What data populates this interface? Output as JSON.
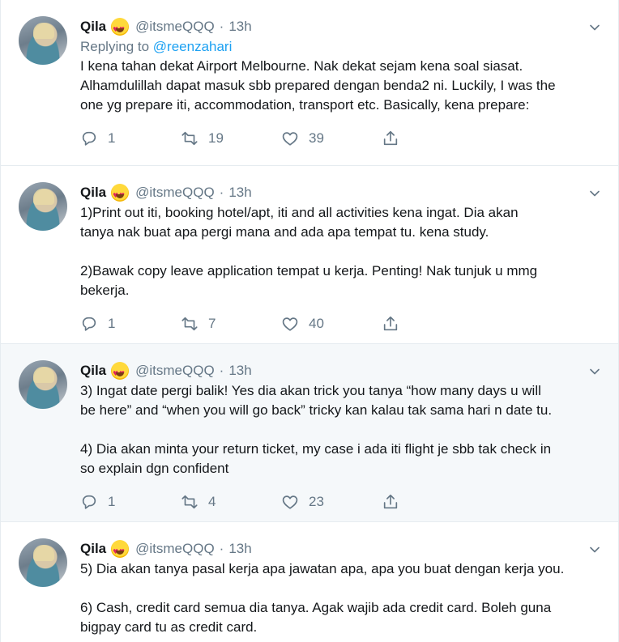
{
  "tweets": [
    {
      "name": "Qila",
      "handle": "@itsmeQQQ",
      "separator": "·",
      "time": "13h",
      "replying_prefix": "Replying to ",
      "replying_to": "@reenzahari",
      "text": "I kena tahan dekat Airport Melbourne. Nak dekat sejam kena soal siasat.\nAlhamdulillah dapat masuk sbb prepared dengan benda2 ni. Luckily, I was the\none yg prepare iti, accommodation, transport etc. Basically, kena prepare:",
      "replies": "1",
      "retweets": "19",
      "likes": "39"
    },
    {
      "name": "Qila",
      "handle": "@itsmeQQQ",
      "separator": "·",
      "time": "13h",
      "text": "1)Print out iti, booking hotel/apt, iti and all activities kena ingat. Dia akan\ntanya nak buat apa pergi mana and ada apa tempat tu. kena study.\n\n2)Bawak copy leave application tempat u kerja. Penting! Nak tunjuk u mmg\nbekerja.",
      "replies": "1",
      "retweets": "7",
      "likes": "40"
    },
    {
      "name": "Qila",
      "handle": "@itsmeQQQ",
      "separator": "·",
      "time": "13h",
      "text": "3) Ingat date pergi balik! Yes dia akan trick you tanya “how many days u will\nbe here” and “when you will go back” tricky kan kalau tak sama hari n date tu.\n\n4) Dia akan minta your return ticket, my case i ada iti flight je sbb tak check in\nso explain dgn confident",
      "replies": "1",
      "retweets": "4",
      "likes": "23"
    },
    {
      "name": "Qila",
      "handle": "@itsmeQQQ",
      "separator": "·",
      "time": "13h",
      "text": "5) Dia akan tanya pasal kerja apa jawatan apa, apa you buat dengan kerja you.\n\n6) Cash, credit card semua dia tanya. Agak wajib ada credit card. Boleh guna\nbigpay card tu as credit card."
    }
  ],
  "icons": {
    "reply": "reply-icon",
    "retweet": "retweet-icon",
    "like": "heart-icon",
    "share": "share-icon",
    "more": "chevron-down-icon",
    "emoji": "star-struck-emoji-icon"
  },
  "colors": {
    "link": "#1da1f2",
    "muted": "#657786",
    "focused_bg": "#f5f8fa"
  }
}
